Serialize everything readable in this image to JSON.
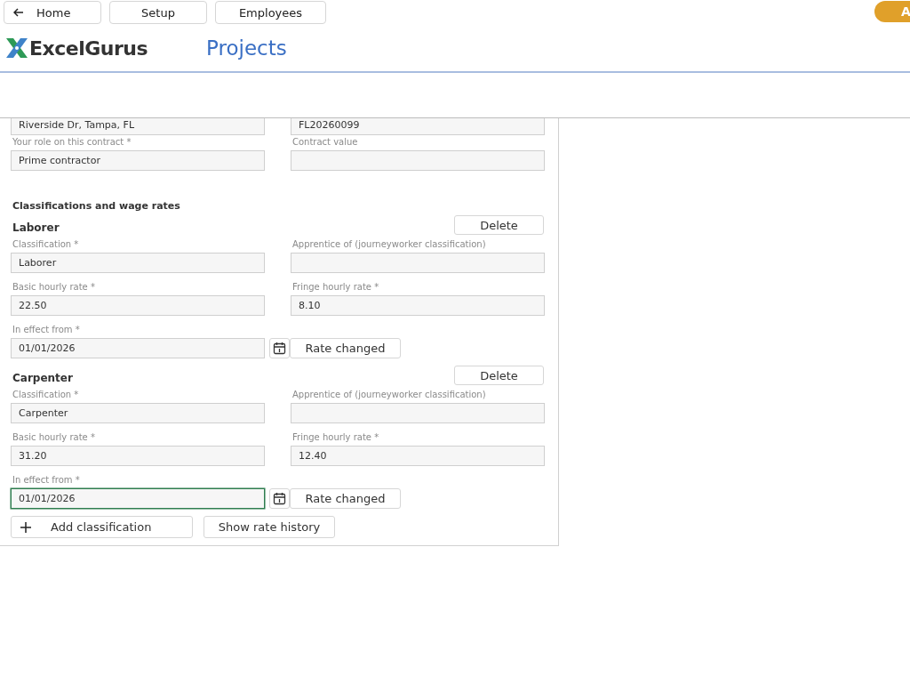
{
  "nav": [
    {
      "label": "Home",
      "kind": "back"
    },
    {
      "label": "Setup"
    },
    {
      "label": "Employees"
    }
  ],
  "user_badge": "A",
  "brand": "ExcelGurus",
  "page_title": "Projects",
  "clipped_fields": [
    {
      "value": "Riverside Dr, Tampa, FL"
    },
    {
      "value": "FL20260099"
    }
  ],
  "contract_fields": [
    {
      "label": "Your role on this contract *",
      "value": "Prime contractor"
    },
    {
      "label": "Contract value"
    }
  ],
  "section_title": "Classifications and wage rates",
  "classifications": [
    {
      "name": "Laborer",
      "delete": "Delete",
      "fields": [
        {
          "label": "Classification *",
          "value": "Laborer"
        },
        {
          "label": "Apprentice of (journeyworker classification)"
        },
        {
          "label": "Basic hourly rate *",
          "value": "22.50"
        },
        {
          "label": "Fringe hourly rate *",
          "value": "8.10"
        }
      ],
      "effective": {
        "label": "In effect from *",
        "value": "01/01/2026",
        "focused": false
      },
      "rate_button": "Rate changed"
    },
    {
      "name": "Carpenter",
      "delete": "Delete",
      "fields": [
        {
          "label": "Classification *",
          "value": "Carpenter"
        },
        {
          "label": "Apprentice of (journeyworker classification)"
        },
        {
          "label": "Basic hourly rate *",
          "value": "31.20"
        },
        {
          "label": "Fringe hourly rate *",
          "value": "12.40"
        }
      ],
      "effective": {
        "label": "In effect from *",
        "value": "01/01/2026",
        "focused": true
      },
      "rate_button": "Rate changed"
    }
  ],
  "actions": [
    {
      "label": "Add classification",
      "kind": "plus"
    },
    {
      "label": "Show rate history"
    }
  ]
}
